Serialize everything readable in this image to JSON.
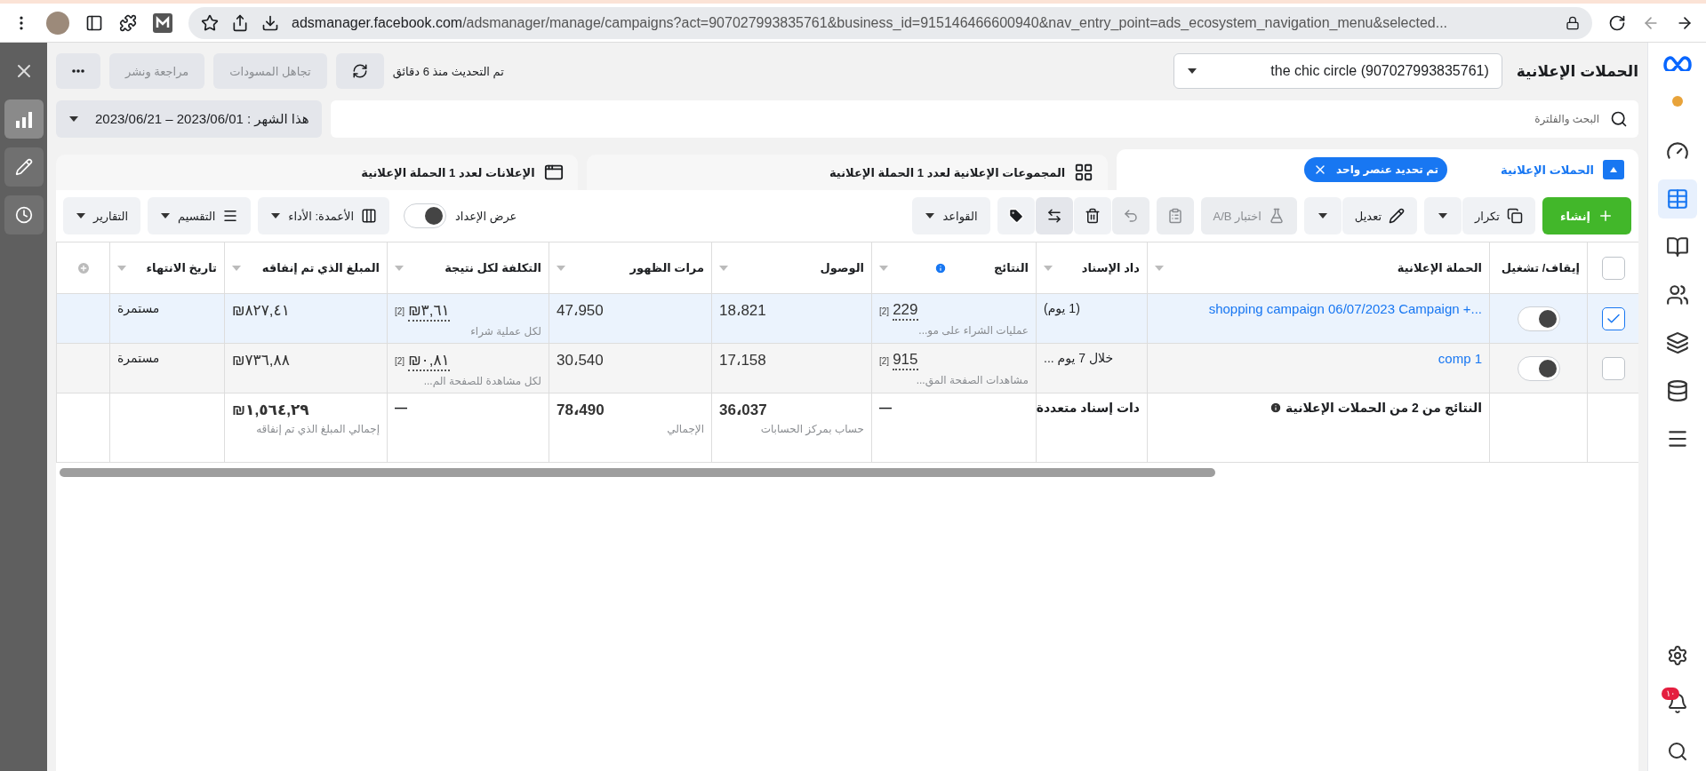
{
  "browser": {
    "domain": "adsmanager.facebook.com",
    "path": "/adsmanager/manage/campaigns?act=907027993835761&business_id=915146466600940&nav_entry_point=ads_ecosystem_navigation_menu&selected..."
  },
  "left_rail": [
    {
      "selected": true
    },
    {
      "selected": false
    },
    {
      "selected": false
    }
  ],
  "right_nav": {
    "items": [
      {
        "selected": false
      },
      {
        "selected": true
      },
      {
        "selected": false
      },
      {
        "selected": false
      },
      {
        "selected": false
      },
      {
        "selected": false
      }
    ],
    "notification_badge": "١٠"
  },
  "header": {
    "title": "الحملات الإعلانية",
    "account": "the chic circle (907027993835761)",
    "updated": "تم التحديث منذ 6 دقائق",
    "buttons": [
      {
        "label": "تجاهل المسودات",
        "disabled": true
      },
      {
        "label": "مراجعة ونشر",
        "disabled": true
      }
    ]
  },
  "search": {
    "placeholder": "البحث والفلترة"
  },
  "date_range": "هذا الشهر : 2023/06/01 – 2023/06/21",
  "tabs": [
    {
      "label": "الحملات الإعلانية",
      "selected": true,
      "chip": "تم تحديد عنصر واحد"
    },
    {
      "label": "المجموعات الإعلانية لعدد 1 الحملة الإعلانية",
      "selected": false
    },
    {
      "label": "الإعلانات لعدد 1 الحملة الإعلانية",
      "selected": false
    }
  ],
  "toolbar": {
    "create": "إنشاء",
    "duplicate": "تكرار",
    "edit": "تعديل",
    "ab_test": {
      "label": "اختبار A/B",
      "disabled": true
    },
    "rules": "القواعد",
    "view_setup": {
      "label": "عرض الإعداد",
      "on": true
    },
    "columns": "الأعمدة: الأداء",
    "breakdown": "التقسيم",
    "reports": "التقارير"
  },
  "table": {
    "select_all": {
      "checked": false
    },
    "columns": [
      "إيقاف/ تشغيل",
      "الحملة الإعلانية",
      "داد الإسناد",
      "النتائج",
      "الوصول",
      "مرات الظهور",
      "التكلفة لكل نتيجة",
      "المبلغ الذي تم إنفاقه",
      "تاريخ الانتهاء"
    ],
    "rows": [
      {
        "selected": true,
        "on": true,
        "name": "shopping campaign 06/07/2023 Campaign +...",
        "attribution": "(1 يوم)",
        "results": "229",
        "results_note": "[2]",
        "results_label": "عمليات الشراء على مو...",
        "reach": "18،821",
        "impressions": "47،950",
        "cost": "₪٣,٦١",
        "cost_note": "[2]",
        "cost_label": "لكل عملية شراء",
        "spent": "₪٨٢٧,٤١",
        "end": "مستمرة"
      },
      {
        "selected": false,
        "on": true,
        "name": "comp 1",
        "attribution": "خلال 7 يوم ...",
        "results": "915",
        "results_note": "[2]",
        "results_label": "مشاهدات الصفحة المق...",
        "reach": "17،158",
        "impressions": "30،540",
        "cost": "₪٠,٨١",
        "cost_note": "[2]",
        "cost_label": "لكل مشاهدة للصفحة الم...",
        "spent": "₪٧٣٦,٨٨",
        "end": "مستمرة"
      }
    ],
    "total": {
      "name": "النتائج من 2 من الحملات الإعلانية",
      "attribution": "دات إسناد متعددة",
      "results": "—",
      "reach": "36،037",
      "reach_label": "حساب بمركز الحسابات",
      "impressions": "78،490",
      "impressions_label": "الإجمالي",
      "cost": "—",
      "spent": "₪١,٥٦٤,٢٩",
      "spent_label": "إجمالي المبلغ الذي تم إنفاقه"
    }
  }
}
